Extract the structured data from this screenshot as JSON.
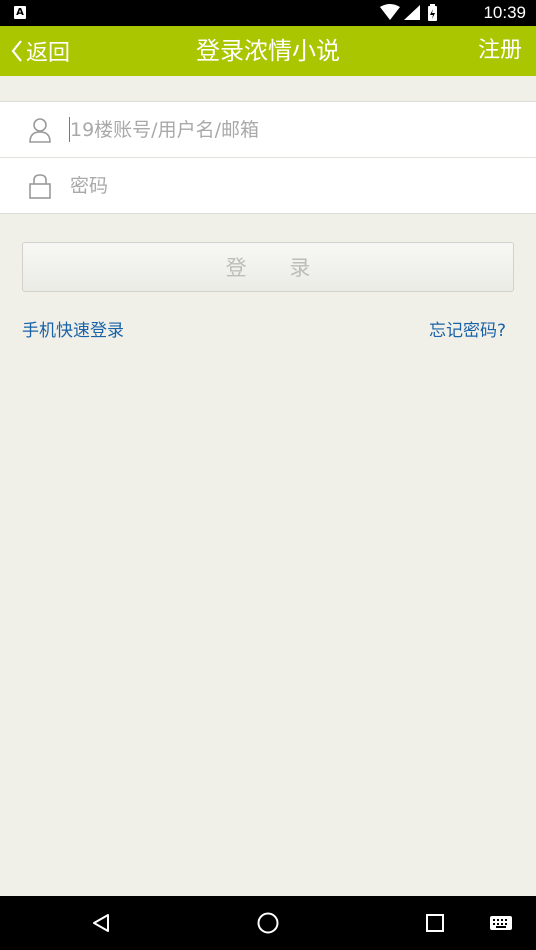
{
  "status_bar": {
    "time": "10:39",
    "left_badge": "A"
  },
  "header": {
    "back_label": "返回",
    "title": "登录浓情小说",
    "register_label": "注册"
  },
  "form": {
    "username_placeholder": "19楼账号/用户名/邮箱",
    "password_placeholder": "密码"
  },
  "login_button": "登 录",
  "links": {
    "phone_login": "手机快速登录",
    "forgot_password": "忘记密码?"
  },
  "colors": {
    "accent": "#a9c600",
    "link": "#1a62a8",
    "background": "#f1f0e8"
  },
  "icons": [
    "user-icon",
    "lock-icon",
    "chevron-left-icon",
    "wifi-icon",
    "signal-icon",
    "battery-icon",
    "back-triangle-icon",
    "home-circle-icon",
    "recents-square-icon",
    "keyboard-icon"
  ]
}
